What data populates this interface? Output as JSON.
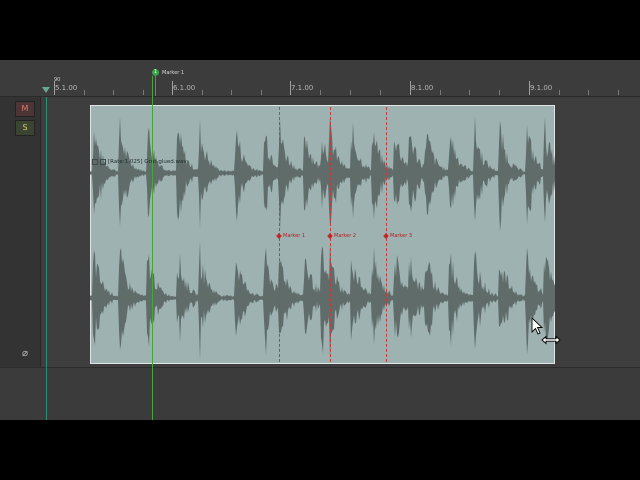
{
  "ruler": {
    "tempo": "90",
    "ticks": [
      {
        "label": "5.1.00"
      },
      {
        "label": "6.1.00"
      },
      {
        "label": "7.1.00"
      },
      {
        "label": "8.1.00"
      },
      {
        "label": "9.1.00"
      }
    ]
  },
  "project_marker": {
    "number": "1",
    "label": "Marker 1"
  },
  "track": {
    "mute_label": "M",
    "solo_label": "S",
    "phase_icon": "phase-invert-icon"
  },
  "item": {
    "header": "[Rate:1.025] Grut-glued.wav",
    "fill_color": "#9db2b1",
    "waveform_color": "#5f6c6a"
  },
  "stretch_markers": [
    {
      "label": "Marker 1"
    },
    {
      "label": "Marker 2"
    },
    {
      "label": "Marker 3"
    }
  ],
  "cursor": {
    "icon": "resize-horizontal-cursor-icon"
  },
  "colors": {
    "marker_green": "#3ba24a",
    "stretch_marker_red": "#c32424"
  }
}
